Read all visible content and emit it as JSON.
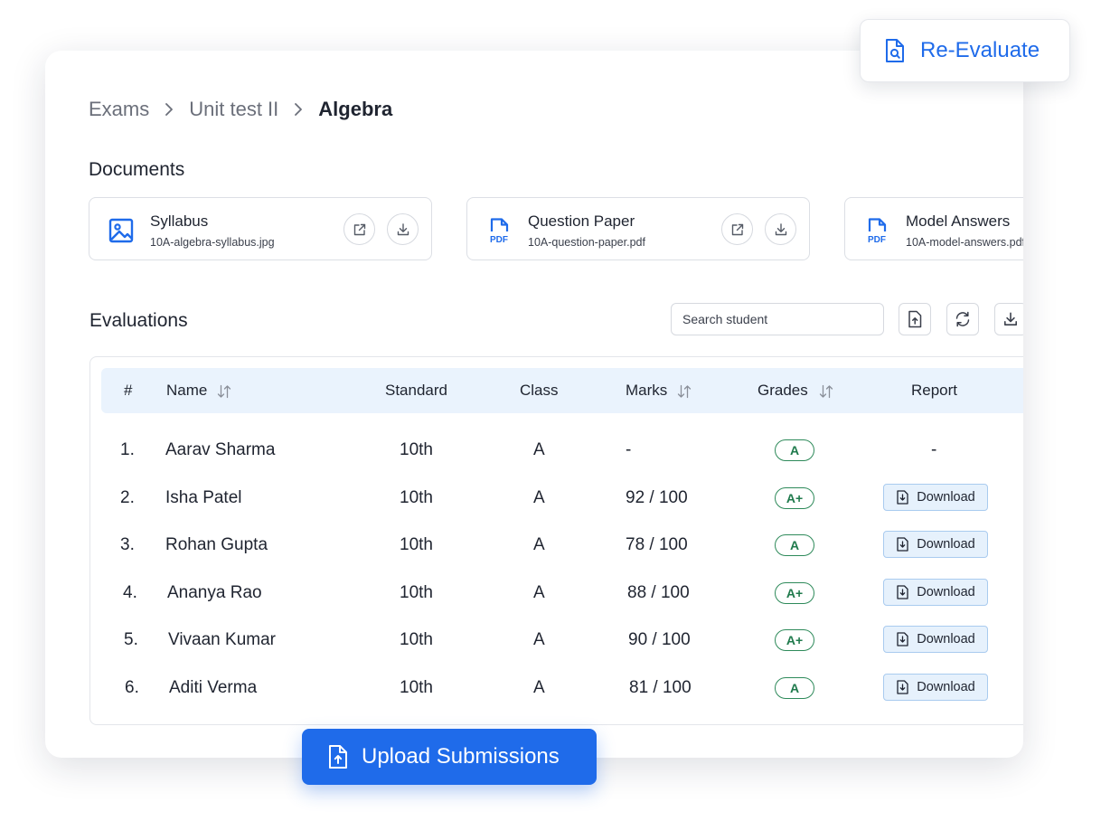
{
  "breadcrumb": {
    "items": [
      "Exams",
      "Unit test II",
      "Algebra"
    ]
  },
  "documents": {
    "title": "Documents",
    "items": [
      {
        "name": "Syllabus",
        "file": "10A-algebra-syllabus.jpg",
        "icon": "image-icon"
      },
      {
        "name": "Question Paper",
        "file": "10A-question-paper.pdf",
        "icon": "pdf-icon"
      },
      {
        "name": "Model Answers",
        "file": "10A-model-answers.pdf",
        "icon": "pdf-icon"
      }
    ]
  },
  "evaluations": {
    "title": "Evaluations",
    "search_placeholder": "Search student",
    "columns": [
      "#",
      "Name",
      "Standard",
      "Class",
      "Marks",
      "Grades",
      "Report"
    ],
    "rows": [
      {
        "num": "1.",
        "name": "Aarav Sharma",
        "standard": "10th",
        "class": "A",
        "marks": "-",
        "grade": "A",
        "report": "-"
      },
      {
        "num": "2.",
        "name": "Isha Patel",
        "standard": "10th",
        "class": "A",
        "marks": "92 / 100",
        "grade": "A+",
        "report": "Download"
      },
      {
        "num": "3.",
        "name": "Rohan Gupta",
        "standard": "10th",
        "class": "A",
        "marks": "78 / 100",
        "grade": "A",
        "report": "Download"
      },
      {
        "num": "4.",
        "name": "Ananya Rao",
        "standard": "10th",
        "class": "A",
        "marks": "88 / 100",
        "grade": "A+",
        "report": "Download"
      },
      {
        "num": "5.",
        "name": "Vivaan Kumar",
        "standard": "10th",
        "class": "A",
        "marks": "90 / 100",
        "grade": "A+",
        "report": "Download"
      },
      {
        "num": "6.",
        "name": "Aditi Verma",
        "standard": "10th",
        "class": "A",
        "marks": "81 / 100",
        "grade": "A",
        "report": "Download"
      }
    ]
  },
  "actions": {
    "re_evaluate": "Re-Evaluate",
    "upload_submissions": "Upload Submissions"
  },
  "colors": {
    "accent": "#1f6bea",
    "grade_badge": "#2e8a5a",
    "table_header_bg": "#eaf3fd",
    "download_bg": "#e6f1fc"
  }
}
